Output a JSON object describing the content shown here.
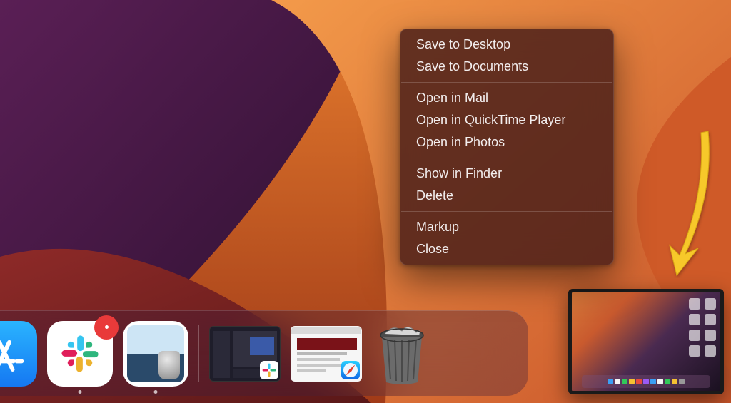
{
  "menu": {
    "groups": [
      [
        "Save to Desktop",
        "Save to Documents"
      ],
      [
        "Open in Mail",
        "Open in QuickTime Player",
        "Open in Photos"
      ],
      [
        "Show in Finder",
        "Delete"
      ],
      [
        "Markup",
        "Close"
      ]
    ]
  },
  "dock": {
    "apps": [
      {
        "name": "appstore",
        "label": "App Store",
        "running": false,
        "badge": false
      },
      {
        "name": "slack",
        "label": "Slack",
        "running": true,
        "badge": true
      },
      {
        "name": "preview",
        "label": "Preview",
        "running": true,
        "badge": false
      }
    ],
    "minimized": [
      {
        "name": "slack-window",
        "theme": "dark",
        "app": "slack"
      },
      {
        "name": "safari-window",
        "theme": "light",
        "app": "safari"
      }
    ],
    "trash_label": "Trash"
  },
  "annotation": {
    "arrow_target": "screenshot-thumbnail"
  }
}
